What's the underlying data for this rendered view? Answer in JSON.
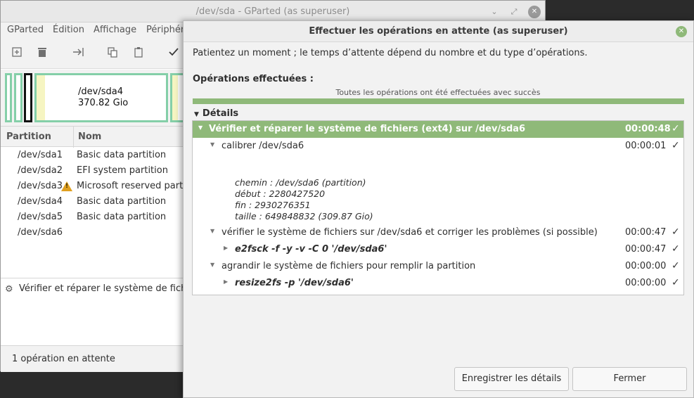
{
  "main_window": {
    "title": "/dev/sda - GParted (as superuser)",
    "controls": {
      "minimize": "⌄",
      "maximize": "⤢",
      "close": "✕"
    },
    "menu": [
      "GParted",
      "Édition",
      "Affichage",
      "Périphéri"
    ],
    "disk_map": {
      "selected_partition": "/dev/sda4",
      "selected_size": "370.82 Gio"
    },
    "partition_table": {
      "headers": [
        "Partition",
        "Nom"
      ],
      "rows": [
        {
          "partition": "/dev/sda1",
          "name": "Basic data partition",
          "warning": false
        },
        {
          "partition": "/dev/sda2",
          "name": "EFI system partition",
          "warning": false
        },
        {
          "partition": "/dev/sda3",
          "name": "Microsoft reserved partiti",
          "warning": true
        },
        {
          "partition": "/dev/sda4",
          "name": "Basic data partition",
          "warning": false
        },
        {
          "partition": "/dev/sda5",
          "name": "Basic data partition",
          "warning": false
        },
        {
          "partition": "/dev/sda6",
          "name": "",
          "warning": false
        }
      ]
    },
    "pending_operation": "Vérifier et réparer le système de fichiers",
    "status": "1 opération en attente"
  },
  "dialog": {
    "title": "Effectuer les opérations en attente (as superuser)",
    "message": "Patientez un moment ; le temps d’attente dépend du nombre et du type d’opérations.",
    "operations_label": "Opérations effectuées :",
    "progress_text": "Toutes les opérations ont été effectuées avec succès",
    "progress": 1.0,
    "details_label": "Détails",
    "tree": {
      "main": {
        "label": "Vérifier et réparer le système de fichiers (ext4) sur /dev/sda6",
        "time": "00:00:48"
      },
      "calibrate": {
        "label": "calibrer /dev/sda6",
        "time": "00:00:01",
        "details": [
          "chemin : /dev/sda6 (partition)",
          "début : 2280427520",
          "fin : 2930276351",
          "taille : 649848832 (309.87 Gio)"
        ]
      },
      "check": {
        "label": "vérifier le système de fichiers sur /dev/sda6 et corriger les problèmes (si possible)",
        "time": "00:00:47"
      },
      "check_cmd": {
        "label": "e2fsck -f -y -v -C 0 '/dev/sda6'",
        "time": "00:00:47"
      },
      "grow": {
        "label": "agrandir le système de fichiers pour remplir la partition",
        "time": "00:00:00"
      },
      "grow_cmd": {
        "label": "resize2fs -p '/dev/sda6'",
        "time": "00:00:00"
      }
    },
    "buttons": {
      "save": "Enregistrer les détails",
      "close": "Fermer"
    },
    "accent_color": "#8fb979"
  }
}
